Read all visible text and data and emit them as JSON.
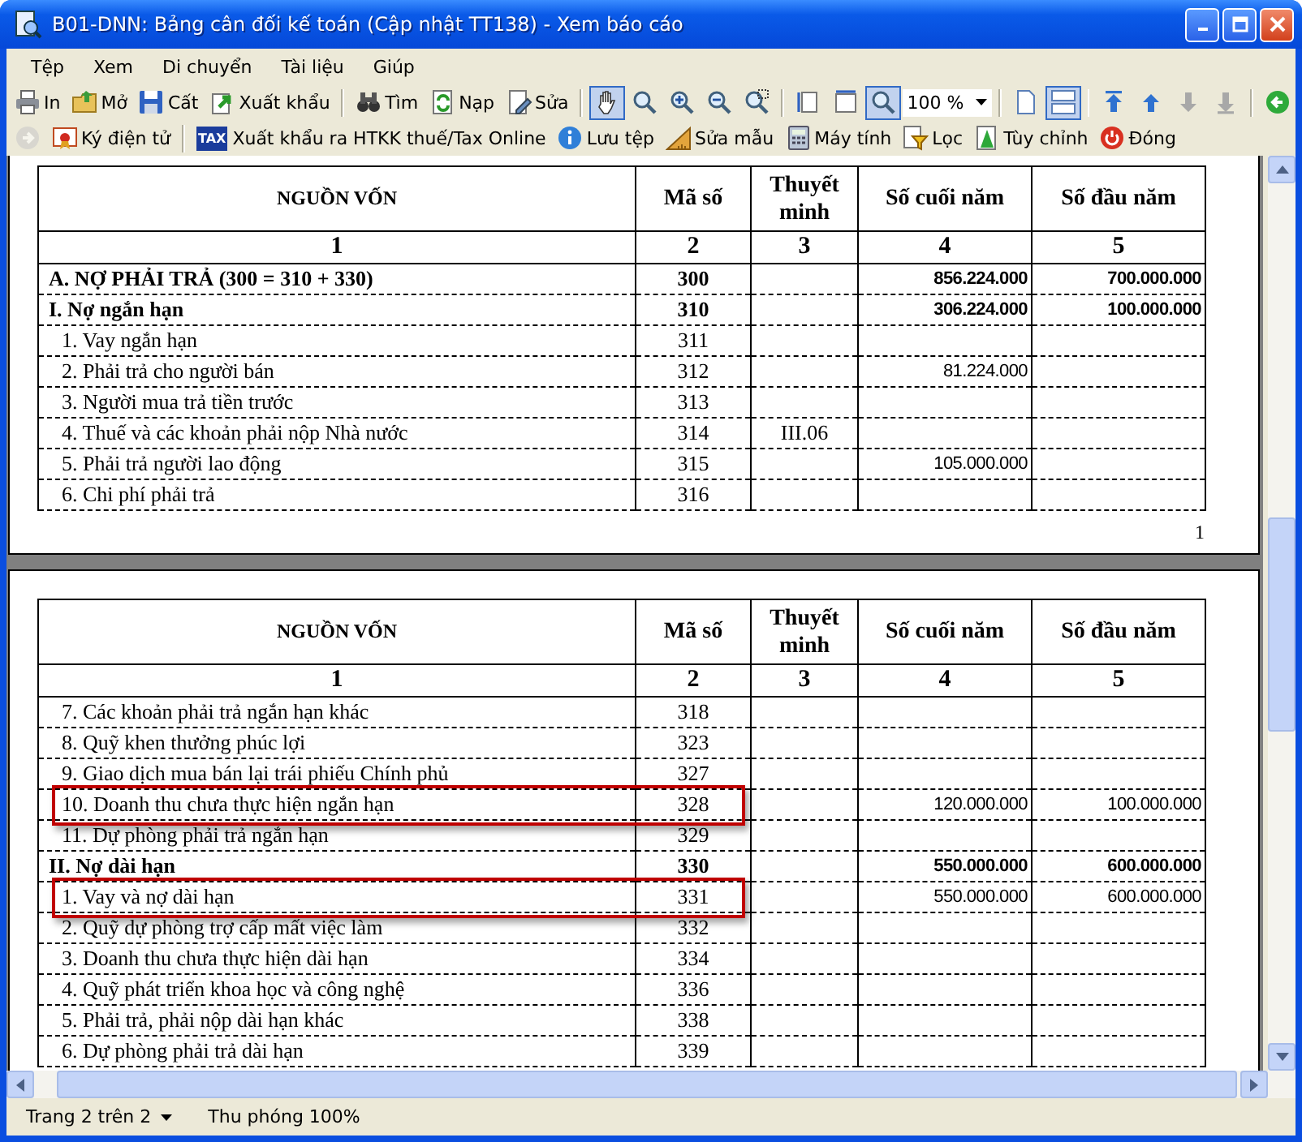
{
  "window": {
    "title": "B01-DNN: Bảng cân đối kế toán (Cập nhật TT138) - Xem báo cáo"
  },
  "menu": [
    "Tệp",
    "Xem",
    "Di chuyển",
    "Tài liệu",
    "Giúp"
  ],
  "toolbar_1": [
    {
      "kind": "button",
      "label": "In"
    },
    {
      "kind": "button",
      "label": "Mở"
    },
    {
      "kind": "button",
      "label": "Cất"
    },
    {
      "kind": "button",
      "label": "Xuất khẩu"
    },
    {
      "kind": "separator"
    },
    {
      "kind": "button",
      "label": "Tìm"
    },
    {
      "kind": "button",
      "label": "Nạp"
    },
    {
      "kind": "button",
      "label": "Sửa"
    },
    {
      "kind": "separator"
    },
    {
      "kind": "icon",
      "selected": true,
      "disabled": false
    },
    {
      "kind": "icon",
      "selected": false,
      "disabled": false
    },
    {
      "kind": "icon",
      "selected": false,
      "disabled": false
    },
    {
      "kind": "icon",
      "selected": false,
      "disabled": false
    },
    {
      "kind": "icon",
      "selected": false,
      "disabled": false
    },
    {
      "kind": "separator"
    },
    {
      "kind": "icon",
      "selected": false,
      "disabled": false
    },
    {
      "kind": "icon",
      "selected": false,
      "disabled": false
    },
    {
      "kind": "icon",
      "selected": true,
      "disabled": false
    },
    {
      "kind": "select",
      "value": "100 %"
    },
    {
      "kind": "separator"
    },
    {
      "kind": "icon",
      "selected": false,
      "disabled": false
    },
    {
      "kind": "icon",
      "selected": true,
      "disabled": false
    },
    {
      "kind": "separator"
    },
    {
      "kind": "icon",
      "selected": false,
      "disabled": false
    },
    {
      "kind": "icon",
      "selected": false,
      "disabled": false
    },
    {
      "kind": "icon",
      "selected": false,
      "disabled": true
    },
    {
      "kind": "icon",
      "selected": false,
      "disabled": true
    },
    {
      "kind": "separator"
    },
    {
      "kind": "icon",
      "selected": false,
      "disabled": false
    }
  ],
  "toolbar_2": [
    {
      "kind": "icon",
      "selected": false,
      "disabled": true
    },
    {
      "kind": "button",
      "label": "Ký điện tử"
    },
    {
      "kind": "separator"
    },
    {
      "kind": "button",
      "label": "Xuất khẩu ra HTKK thuế/Tax Online",
      "badge": "TAX"
    },
    {
      "kind": "button",
      "label": "Lưu tệp"
    },
    {
      "kind": "button",
      "label": "Sửa mẫu"
    },
    {
      "kind": "button",
      "label": "Máy tính"
    },
    {
      "kind": "button",
      "label": "Lọc"
    },
    {
      "kind": "button",
      "label": "Tùy chỉnh"
    },
    {
      "kind": "button",
      "label": "Đóng"
    }
  ],
  "pages": [
    {
      "columns": [
        "NGUỒN VỐN",
        "Mã số",
        "Thuyết minh",
        "Số cuối năm",
        "Số đầu năm"
      ],
      "column_numbers": [
        "1",
        "2",
        "3",
        "4",
        "5"
      ],
      "rows": [
        {
          "name": "A. NỢ PHẢI TRẢ (300 = 310 + 330)",
          "code": "300",
          "end": "856.224.000",
          "begin": "700.000.000",
          "bold": true,
          "highlighted": false
        },
        {
          "name": "I. Nợ ngắn hạn",
          "code": "310",
          "end": "306.224.000",
          "begin": "100.000.000",
          "bold": true,
          "highlighted": false
        },
        {
          "name": "1. Vay ngắn hạn",
          "code": "311",
          "bold": false,
          "highlighted": false
        },
        {
          "name": "2. Phải trả cho người bán",
          "code": "312",
          "end": "81.224.000",
          "bold": false,
          "highlighted": false
        },
        {
          "name": "3. Người mua trả tiền trước",
          "code": "313",
          "bold": false,
          "highlighted": false
        },
        {
          "name": "4. Thuế và các khoản phải nộp Nhà nước",
          "code": "314",
          "note": "III.06",
          "bold": false,
          "highlighted": false
        },
        {
          "name": "5. Phải trả người lao động",
          "code": "315",
          "end": "105.000.000",
          "bold": false,
          "highlighted": false
        },
        {
          "name": "6. Chi phí phải trả",
          "code": "316",
          "bold": false,
          "highlighted": false
        }
      ],
      "page_number": "1"
    },
    {
      "columns": [
        "NGUỒN VỐN",
        "Mã số",
        "Thuyết minh",
        "Số cuối năm",
        "Số đầu năm"
      ],
      "column_numbers": [
        "1",
        "2",
        "3",
        "4",
        "5"
      ],
      "rows": [
        {
          "name": "7. Các khoản phải trả ngắn hạn khác",
          "code": "318",
          "bold": false,
          "highlighted": false
        },
        {
          "name": "8. Quỹ khen thưởng phúc lợi",
          "code": "323",
          "bold": false,
          "highlighted": false
        },
        {
          "name": "9. Giao dịch mua bán lại trái phiếu Chính phủ",
          "code": "327",
          "bold": false,
          "highlighted": false
        },
        {
          "name": "10. Doanh thu chưa thực hiện ngắn hạn",
          "code": "328",
          "end": "120.000.000",
          "begin": "100.000.000",
          "bold": false,
          "highlighted": true
        },
        {
          "name": "11. Dự phòng phải trả ngắn hạn",
          "code": "329",
          "bold": false,
          "highlighted": false
        },
        {
          "name": "II. Nợ dài hạn",
          "code": "330",
          "end": "550.000.000",
          "begin": "600.000.000",
          "bold": true,
          "highlighted": false
        },
        {
          "name": "1. Vay và nợ dài hạn",
          "code": "331",
          "end": "550.000.000",
          "begin": "600.000.000",
          "bold": false,
          "highlighted": true
        },
        {
          "name": "2. Quỹ dự phòng trợ cấp mất việc làm",
          "code": "332",
          "bold": false,
          "highlighted": false
        },
        {
          "name": "3. Doanh thu chưa thực hiện dài hạn",
          "code": "334",
          "bold": false,
          "highlighted": false
        },
        {
          "name": "4. Quỹ phát triển khoa học và công nghệ",
          "code": "336",
          "bold": false,
          "highlighted": false
        },
        {
          "name": "5. Phải trả, phải nộp dài hạn khác",
          "code": "338",
          "bold": false,
          "highlighted": false
        },
        {
          "name": "6. Dự phòng phải trả dài hạn",
          "code": "339",
          "bold": false,
          "highlighted": false
        }
      ]
    }
  ],
  "status_bar": {
    "page": "Trang 2 trên 2",
    "zoom": "Thu phóng 100%"
  }
}
